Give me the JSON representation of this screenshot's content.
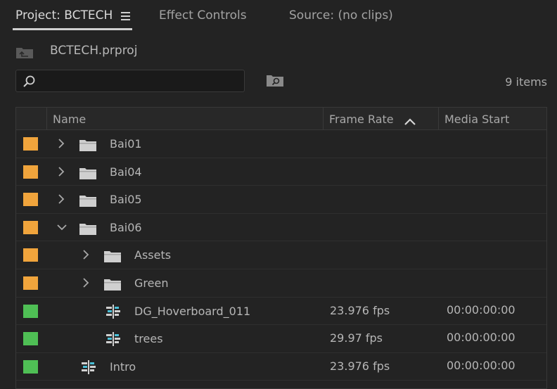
{
  "tabs": [
    {
      "label": "Project: BCTECH",
      "active": true
    },
    {
      "label": "Effect Controls",
      "active": false
    },
    {
      "label": "Source: (no clips)",
      "active": false
    }
  ],
  "project": {
    "name": "BCTECH.prproj"
  },
  "search": {
    "value": "",
    "placeholder": ""
  },
  "item_count": "9 items",
  "columns": {
    "name": "Name",
    "frame_rate": "Frame Rate",
    "media_start": "Media Start"
  },
  "colors": {
    "folder_label": "#f0a43c",
    "sequence_label": "#4fbf55",
    "accent_active": "#dadada"
  },
  "rows": [
    {
      "label_color": "orange",
      "type": "folder",
      "expanded": false,
      "indent": 0,
      "name": "Bai01",
      "frame_rate": "",
      "media_start": ""
    },
    {
      "label_color": "orange",
      "type": "folder",
      "expanded": false,
      "indent": 0,
      "name": "Bai04",
      "frame_rate": "",
      "media_start": ""
    },
    {
      "label_color": "orange",
      "type": "folder",
      "expanded": false,
      "indent": 0,
      "name": "Bai05",
      "frame_rate": "",
      "media_start": ""
    },
    {
      "label_color": "orange",
      "type": "folder",
      "expanded": true,
      "indent": 0,
      "name": "Bai06",
      "frame_rate": "",
      "media_start": ""
    },
    {
      "label_color": "orange",
      "type": "folder",
      "expanded": false,
      "indent": 1,
      "name": "Assets",
      "frame_rate": "",
      "media_start": ""
    },
    {
      "label_color": "orange",
      "type": "folder",
      "expanded": false,
      "indent": 1,
      "name": "Green",
      "frame_rate": "",
      "media_start": ""
    },
    {
      "label_color": "green",
      "type": "sequence",
      "indent": 1,
      "name": "DG_Hoverboard_011",
      "frame_rate": "23.976 fps",
      "media_start": "00:00:00:00"
    },
    {
      "label_color": "green",
      "type": "sequence",
      "indent": 1,
      "name": "trees",
      "frame_rate": "29.97 fps",
      "media_start": "00:00:00:00"
    },
    {
      "label_color": "green",
      "type": "sequence",
      "indent": 0,
      "name": "Intro",
      "frame_rate": "23.976 fps",
      "media_start": "00:00:00:00"
    }
  ]
}
